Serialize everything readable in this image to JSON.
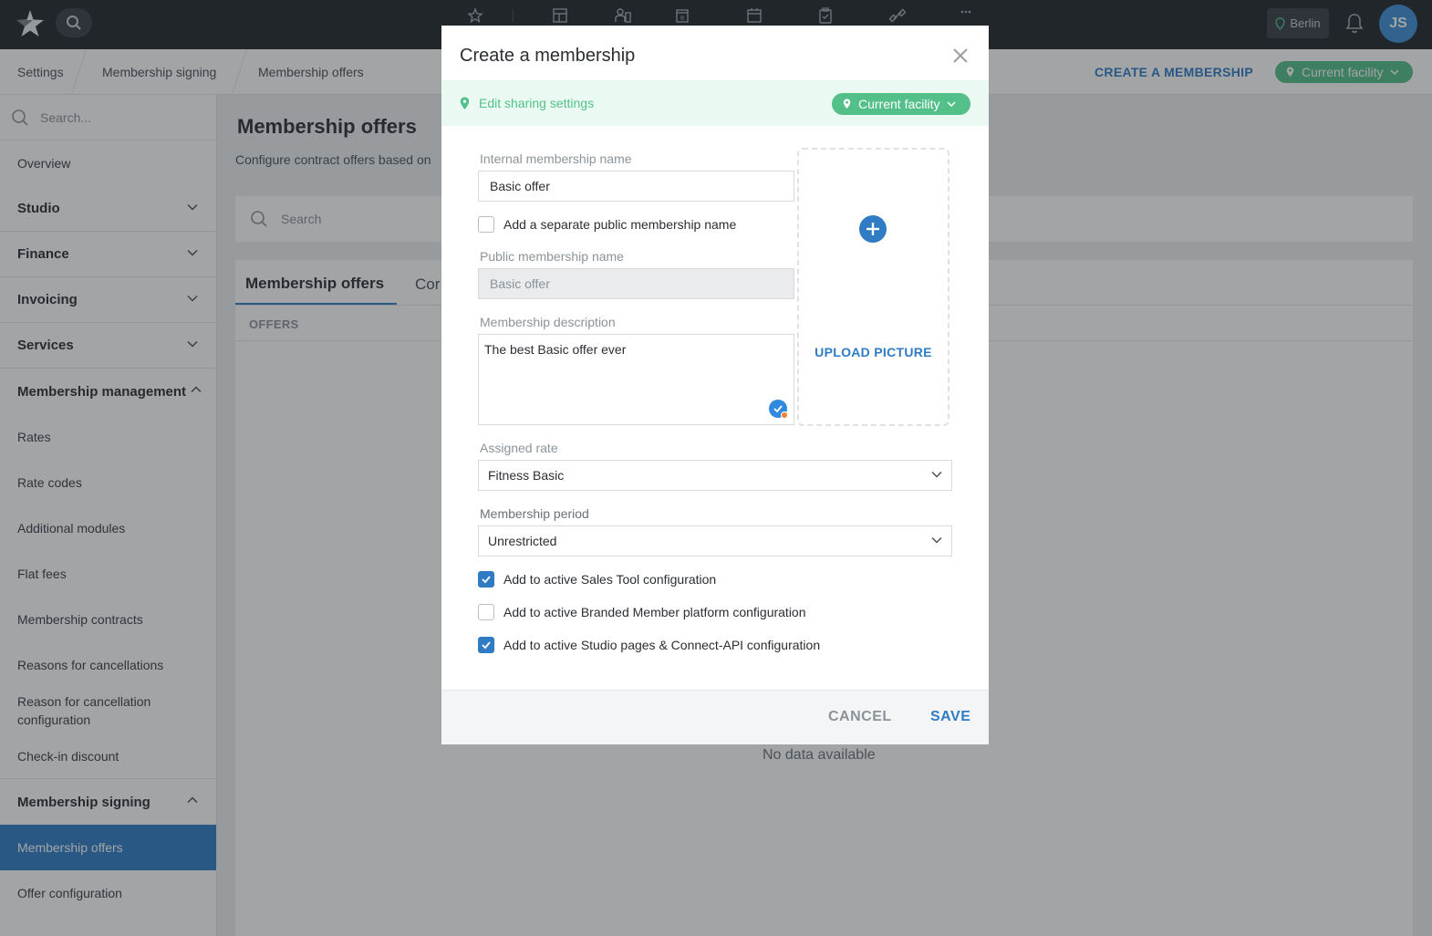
{
  "topbar": {
    "location": "Berlin",
    "avatar_initials": "JS",
    "nav_icons": [
      "star-icon",
      "layout-icon",
      "members-icon",
      "calendar-8-icon",
      "calendar-icon",
      "clipboard-icon",
      "dumbbell-icon",
      "more-icon"
    ]
  },
  "breadcrumb": {
    "items": [
      "Settings",
      "Membership signing",
      "Membership offers"
    ],
    "create_label": "CREATE A MEMBERSHIP",
    "facility_label": "Current facility"
  },
  "sidebar": {
    "search_placeholder": "Search...",
    "items": [
      {
        "label": "Overview"
      },
      {
        "label": "Studio"
      },
      {
        "label": "Finance"
      },
      {
        "label": "Invoicing"
      },
      {
        "label": "Services"
      },
      {
        "label": "Membership management"
      },
      {
        "label": "Rates"
      },
      {
        "label": "Rate codes"
      },
      {
        "label": "Additional modules"
      },
      {
        "label": "Flat fees"
      },
      {
        "label": "Membership contracts"
      },
      {
        "label": "Reasons for cancellations"
      },
      {
        "label": "Reason for cancellation configuration"
      },
      {
        "label": "Check-in discount"
      },
      {
        "label": "Membership signing"
      },
      {
        "label": "Membership offers"
      },
      {
        "label": "Offer configuration"
      }
    ]
  },
  "main": {
    "title": "Membership offers",
    "subtitle": "Configure contract offers based on",
    "search_placeholder": "Search",
    "tabs": [
      {
        "label": "Membership offers"
      },
      {
        "label": "Cor"
      }
    ],
    "offers_header": "OFFERS",
    "empty_text": "No data available"
  },
  "modal": {
    "title": "Create a membership",
    "share_link": "Edit sharing settings",
    "share_facility": "Current facility",
    "internal_name_label": "Internal membership name",
    "internal_name_value": "Basic offer",
    "separate_public_label": "Add a separate public membership name",
    "public_name_label": "Public membership name",
    "public_name_value": "Basic offer",
    "description_label": "Membership description",
    "description_value": "The best Basic offer ever",
    "upload_label": "UPLOAD PICTURE",
    "assigned_rate_label": "Assigned rate",
    "assigned_rate_value": "Fitness Basic",
    "period_label": "Membership period",
    "period_value": "Unrestricted",
    "check_sales": "Add to active Sales Tool configuration",
    "check_branded": "Add to active Branded Member platform configuration",
    "check_studio": "Add to active Studio pages & Connect-API configuration",
    "cancel_label": "CANCEL",
    "save_label": "SAVE"
  },
  "colors": {
    "accent": "#2f7cc4",
    "success": "#53c08a",
    "topbar": "#22262b"
  }
}
